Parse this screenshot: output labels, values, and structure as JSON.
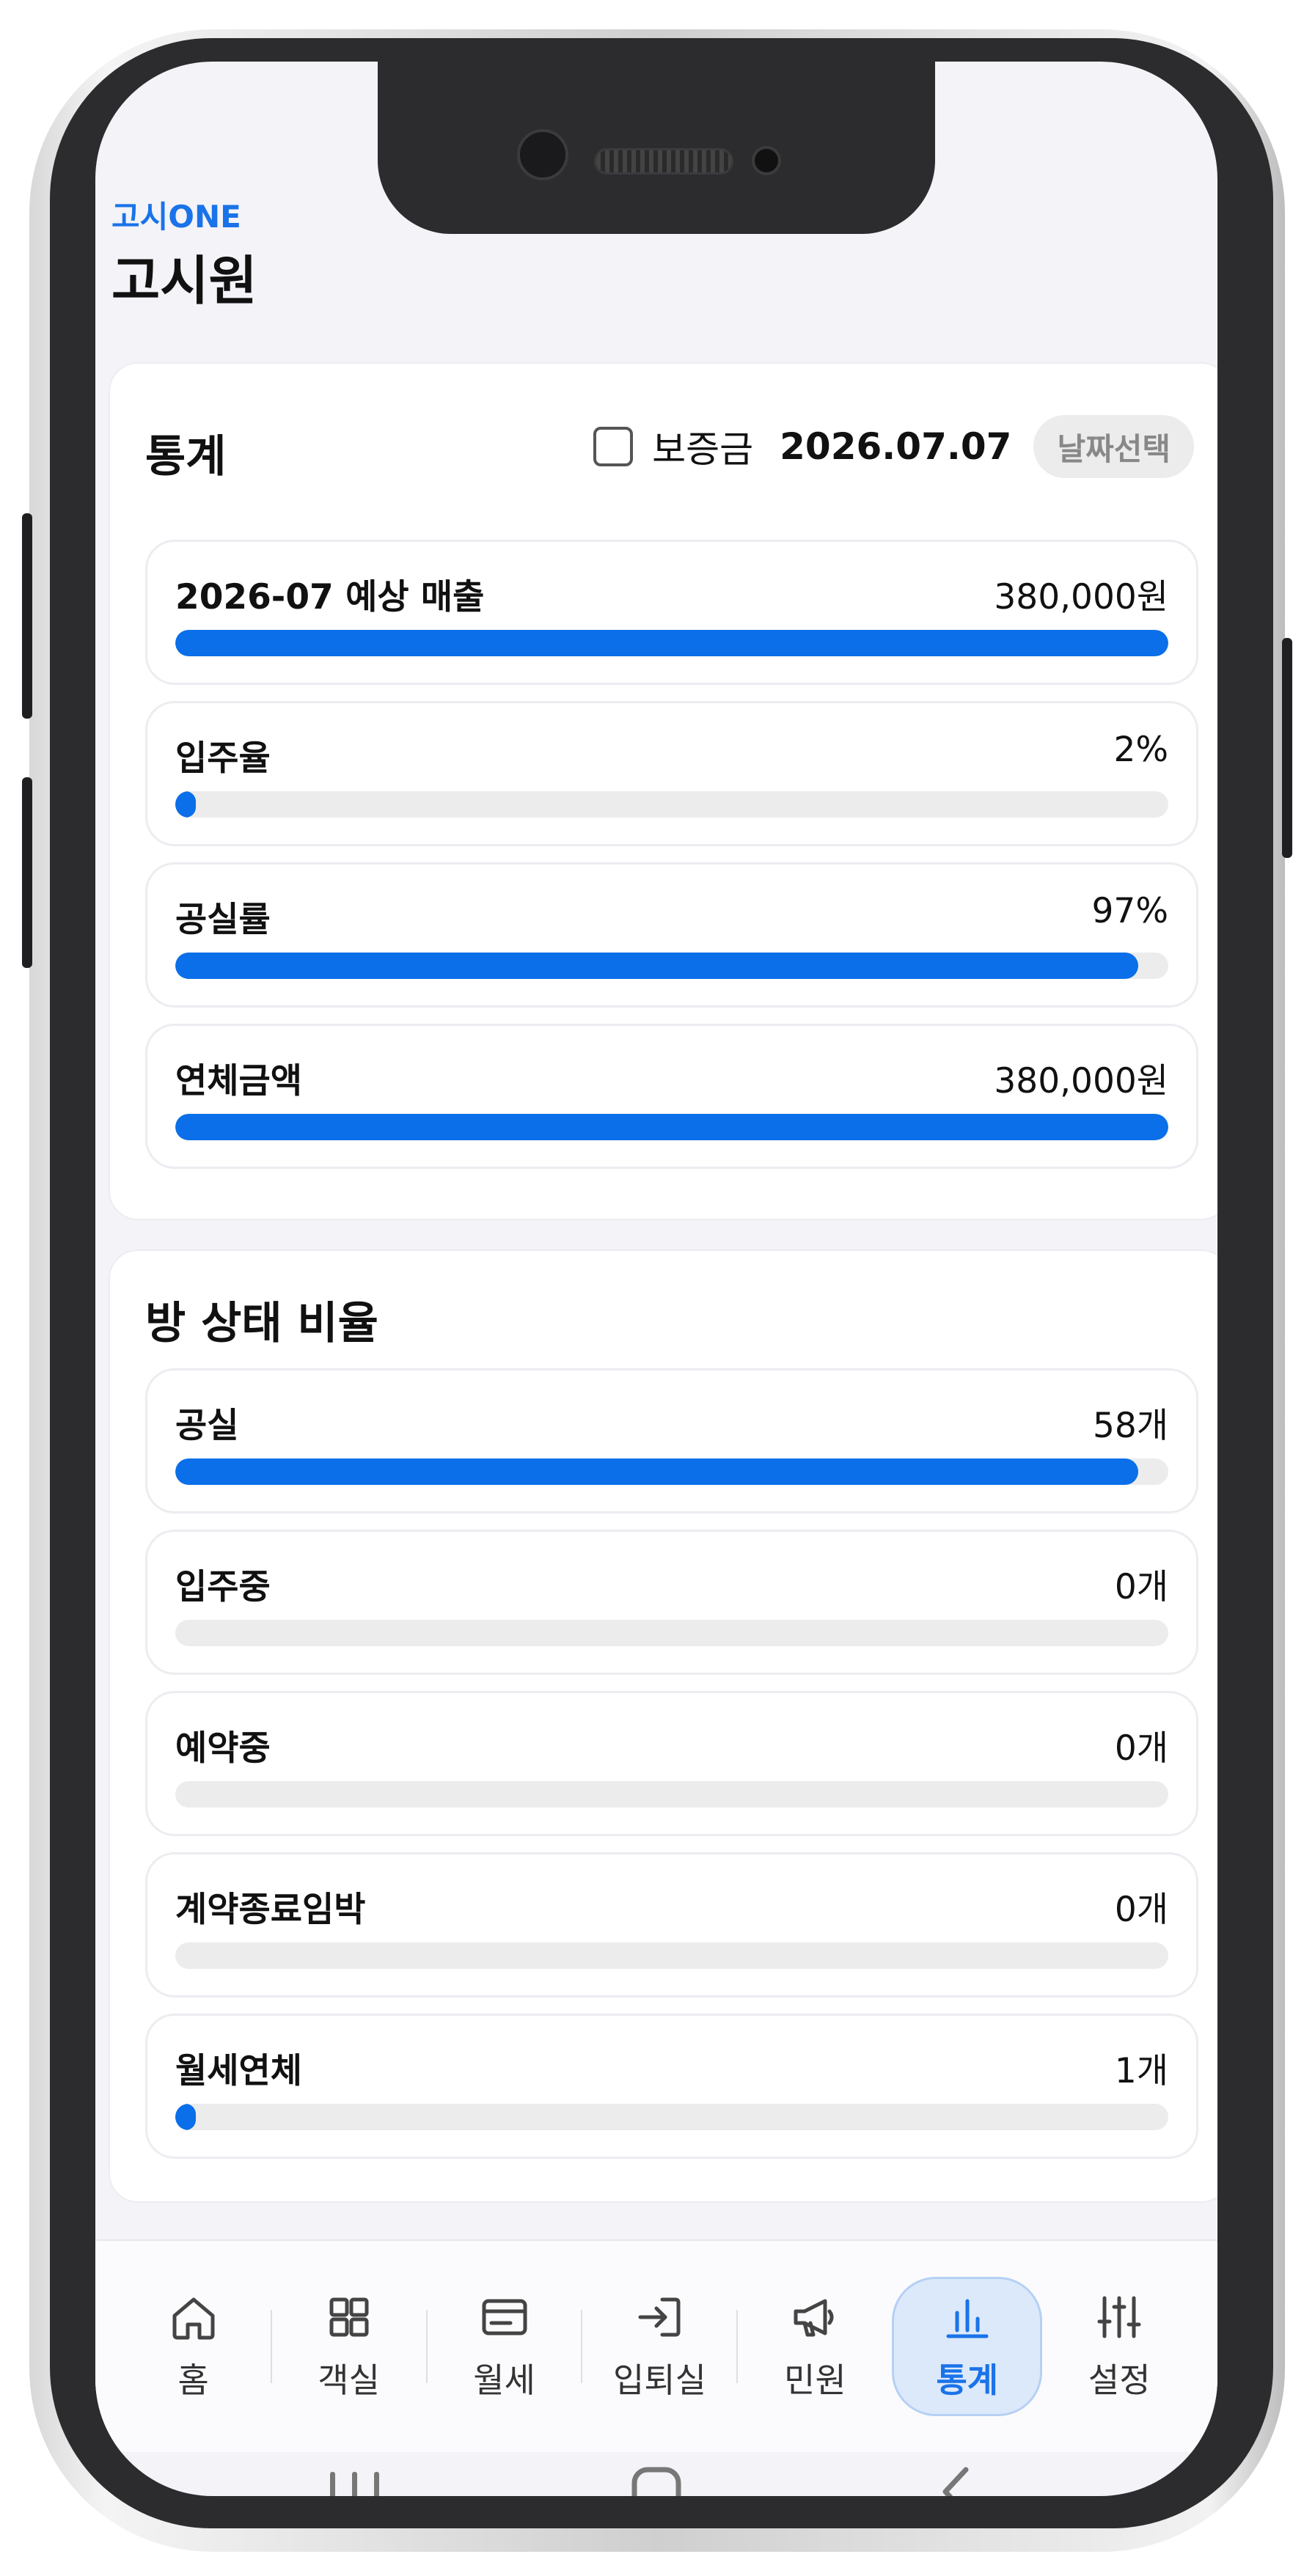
{
  "header": {
    "brand": "고시ONE",
    "title": "고시원"
  },
  "stats_card": {
    "title": "통계",
    "deposit_label": "보증금",
    "deposit_checked": false,
    "date": "2026.07.07",
    "date_button": "날짜선택",
    "metrics": [
      {
        "label": "2026-07 예상 매출",
        "value": "380,000원",
        "fill_percent": 100
      },
      {
        "label": "입주율",
        "value": "2%",
        "fill_percent": 2
      },
      {
        "label": "공실률",
        "value": "97%",
        "fill_percent": 97
      },
      {
        "label": "연체금액",
        "value": "380,000원",
        "fill_percent": 100
      }
    ]
  },
  "rooms_card": {
    "title": "방 상태 비율",
    "metrics": [
      {
        "label": "공실",
        "value": "58개",
        "fill_percent": 97
      },
      {
        "label": "입주중",
        "value": "0개",
        "fill_percent": 0
      },
      {
        "label": "예약중",
        "value": "0개",
        "fill_percent": 0
      },
      {
        "label": "계약종료임박",
        "value": "0개",
        "fill_percent": 0
      },
      {
        "label": "월세연체",
        "value": "1개",
        "fill_percent": 2
      }
    ]
  },
  "bottom_nav": {
    "items": [
      {
        "label": "홈",
        "icon": "home-icon",
        "active": false
      },
      {
        "label": "객실",
        "icon": "grid-icon",
        "active": false
      },
      {
        "label": "월세",
        "icon": "card-icon",
        "active": false
      },
      {
        "label": "입퇴실",
        "icon": "enter-icon",
        "active": false
      },
      {
        "label": "민원",
        "icon": "megaphone-icon",
        "active": false
      },
      {
        "label": "통계",
        "icon": "chart-icon",
        "active": true
      },
      {
        "label": "설정",
        "icon": "sliders-icon",
        "active": false
      }
    ]
  },
  "colors": {
    "accent": "#0a6fe8",
    "brand": "#1a73e8",
    "track": "#ececec",
    "active_nav_bg": "#dce9fb"
  }
}
